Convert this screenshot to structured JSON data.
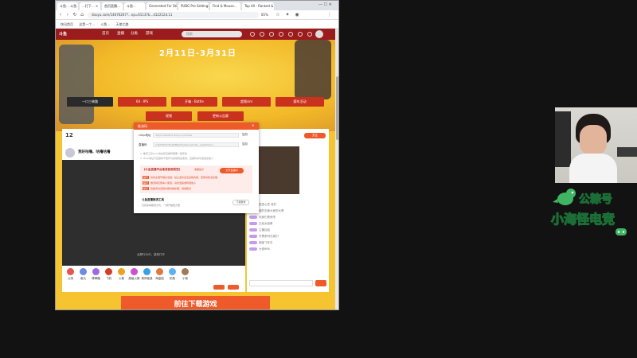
{
  "browser": {
    "tabs": [
      "斗鱼... 斗鱼...",
      "...打下... ×",
      "首页直播...",
      "斗鱼...",
      "Generated For Sti...",
      "PUBG Pro Settings...",
      "Find & Mouse...",
      "Top 40 - Ranked & A..."
    ],
    "url": "douyu.com/14676267?...ep=61137b...d12212d.11",
    "zoom": "85%",
    "bookmarks": [
      "快迅首页",
      "这是一个...",
      "斗鱼...",
      "天使之路"
    ]
  },
  "site": {
    "logo": "斗鱼",
    "nav": [
      "首页",
      "直播",
      "分类",
      "游戏"
    ],
    "search_placeholder": "搜索",
    "banner_date": "2月11日-3月31日",
    "buttons_row1": [
      "一口三峡路",
      "64 · IPS",
      "开箱 · Battle",
      "超频sim",
      "赛年活动"
    ],
    "buttons_row2": [
      "视频",
      "更新公告赛"
    ],
    "room": {
      "level": "12",
      "title": "我好咕噜、咕噜咕噜",
      "player_caption": "全屏行为中，重新打开",
      "cta": "前往下载游戏"
    },
    "gifts": [
      "公测",
      "鱼丸",
      "棒棒糖",
      "飞机",
      "火箭",
      "超级火箭",
      "乘风破浪",
      "海盗船",
      "奶瓶",
      "小熊"
    ],
    "chat": {
      "button": "关注",
      "lines": [
        "歪歪心意 真好",
        "我的天使大家的大哥",
        "玩家们快来吧",
        "正经太极拳",
        "主播加油",
        "开黑来吗兄弟们",
        "超级飞车手",
        "大佬666"
      ]
    }
  },
  "modal": {
    "title": "推流码",
    "rtmp_label": "rtmp地址",
    "rtmp_value": "rtmp://sendtc3.douyu.com/live",
    "key_label": "直播码",
    "key_value": "14676267rIRrJlnBBs9?wsSecret=ab...&wsTime=...",
    "copy": "复制",
    "note1": "1. 推流工具rtmp地址和直播码需要一起修改",
    "note2": "2. rtmp地址与直播码不能作为其他用途使用，直播码请勿泄露给他人",
    "warn_title": "《斗鱼直播平台推流使用规范》",
    "warn_badge": "重要提示",
    "open_button": "打开直播间",
    "warn_lines": [
      "请务必遵守相关法规，禁止发布违法违规内容，否则将依法处理",
      "推流码仅限本人使用，请勿泄露或转借他人",
      "直播间内违规内容将被处理，谢谢配合"
    ],
    "tag": "提示",
    "tool_title": "斗鱼直播推流工具",
    "tool_desc": "支持多种推流方式，一键开播更方便",
    "download": "下载软件"
  },
  "overlay": {
    "brand_line1": "公粽号",
    "brand_line2": "小海怪电竞"
  },
  "colors": {
    "accent": "#ef5a2a",
    "header": "#9a1c1c",
    "banner": "#f6c431"
  }
}
